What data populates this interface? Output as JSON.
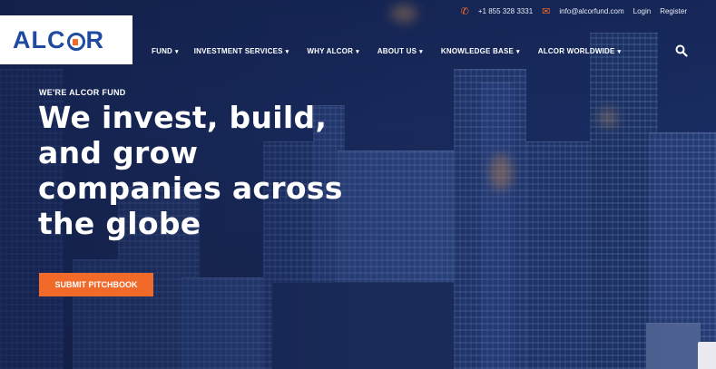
{
  "topbar": {
    "phone": "+1 855 328 3331",
    "email": "info@alcorfund.com",
    "login": "Login",
    "register": "Register"
  },
  "logo": {
    "text_left": "ALC",
    "text_right": "R"
  },
  "nav": {
    "items": [
      "FUND",
      "INVESTMENT SERVICES",
      "WHY ALCOR",
      "ABOUT US",
      "KNOWLEDGE BASE",
      "ALCOR WORLDWIDE"
    ],
    "search_icon": "search-icon"
  },
  "hero": {
    "eyebrow": "WE'RE ALCOR FUND",
    "headline_lines": [
      "We invest, build,",
      "and grow",
      "companies across",
      "the globe"
    ],
    "cta": "SUBMIT PITCHBOOK"
  },
  "colors": {
    "accent": "#f26a2a",
    "brand": "#1f4aa0",
    "background": "#1b2f66"
  }
}
